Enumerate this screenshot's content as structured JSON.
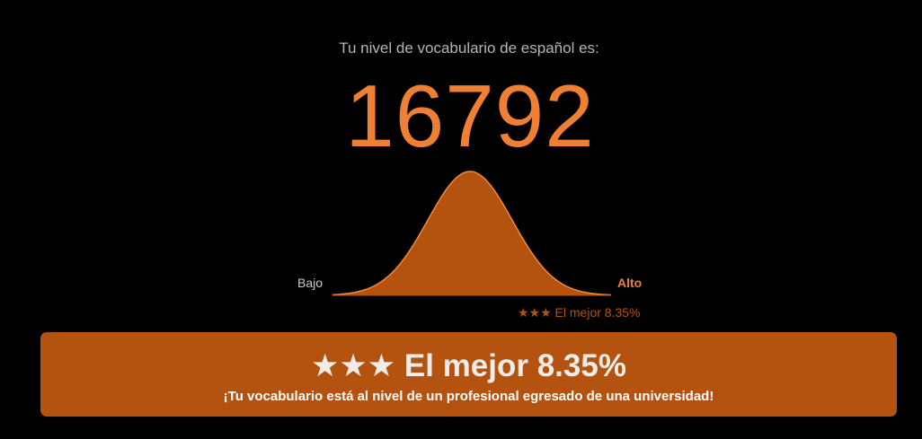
{
  "result": {
    "intro_text": "Tu nivel de vocabulario de español es:",
    "score": "16792",
    "scale_low_label": "Bajo",
    "scale_high_label": "Alto",
    "percentile_small": "★★★ El mejor 8.35%",
    "percentile_headline": "★★★ El mejor 8.35%",
    "description": "¡Tu vocabulario está al nivel de un profesional egresado de una universidad!"
  },
  "colors": {
    "background": "#000000",
    "accent_orange": "#ef7f33",
    "box_brown": "#b3530f",
    "curve_fill": "#b3530f",
    "curve_outline": "#f08a3c",
    "muted_text": "#b5b5b5"
  },
  "distribution": {
    "highlight_percentile": 8.35
  }
}
